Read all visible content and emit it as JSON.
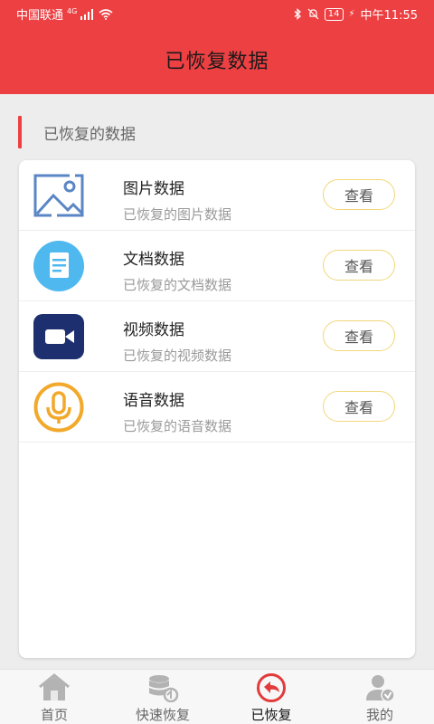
{
  "status_bar": {
    "carrier": "中国联通",
    "network": "4G",
    "battery": "14",
    "time": "中午11:55"
  },
  "header": {
    "title": "已恢复数据"
  },
  "section": {
    "title": "已恢复的数据"
  },
  "items": [
    {
      "title": "图片数据",
      "subtitle": "已恢复的图片数据",
      "button": "查看",
      "icon": "image-icon"
    },
    {
      "title": "文档数据",
      "subtitle": "已恢复的文档数据",
      "button": "查看",
      "icon": "document-icon"
    },
    {
      "title": "视频数据",
      "subtitle": "已恢复的视频数据",
      "button": "查看",
      "icon": "video-camera-icon"
    },
    {
      "title": "语音数据",
      "subtitle": "已恢复的语音数据",
      "button": "查看",
      "icon": "microphone-icon"
    }
  ],
  "tabs": [
    {
      "label": "首页",
      "icon": "home-icon",
      "active": false
    },
    {
      "label": "快速恢复",
      "icon": "database-restore-icon",
      "active": false
    },
    {
      "label": "已恢复",
      "icon": "undo-arrow-icon",
      "active": true
    },
    {
      "label": "我的",
      "icon": "user-verified-icon",
      "active": false
    }
  ],
  "colors": {
    "header": "#ed4043",
    "accent_bar": "#ed4043",
    "button_border": "#f1d77a",
    "document_icon": "#4fb8ef",
    "video_icon": "#1d2f6e",
    "mic_icon": "#f2a92b"
  }
}
